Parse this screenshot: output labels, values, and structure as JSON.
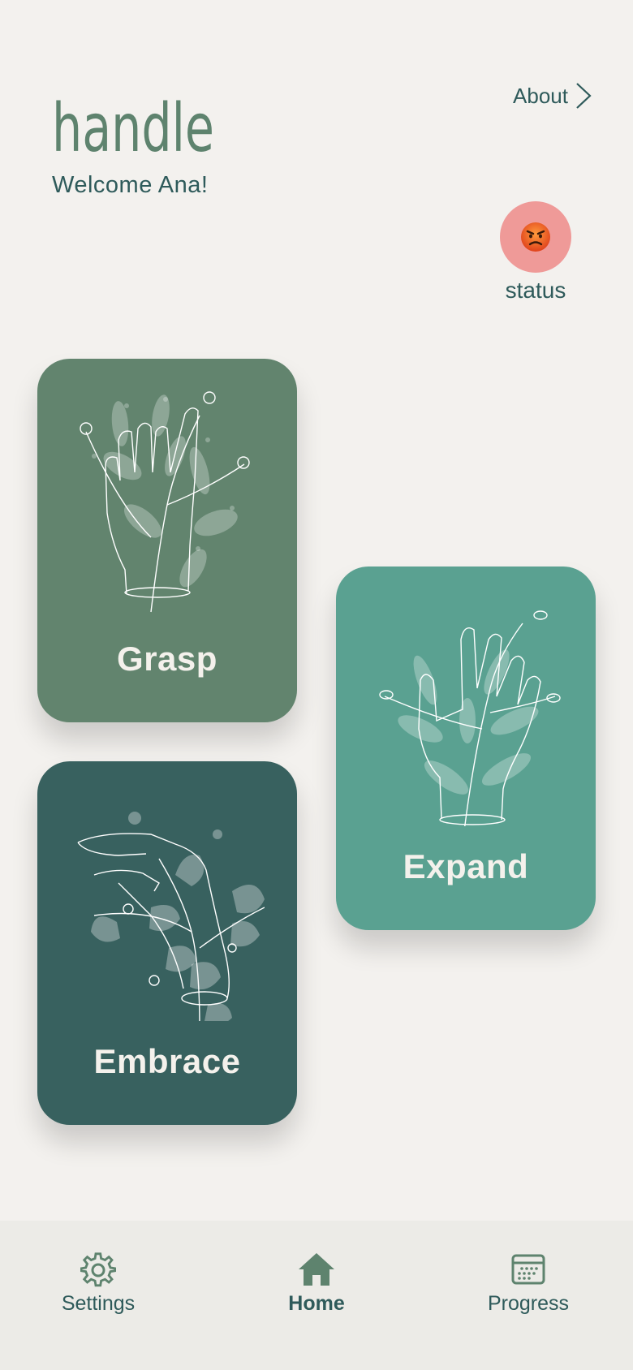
{
  "header": {
    "logo_text": "handle",
    "welcome": "Welcome Ana!",
    "about_label": "About"
  },
  "status": {
    "label": "status",
    "mood_icon": "angry-face-icon",
    "circle_color": "#ef9a98"
  },
  "cards": [
    {
      "label": "Grasp",
      "color": "#62846e"
    },
    {
      "label": "Expand",
      "color": "#5aa191"
    },
    {
      "label": "Embrace",
      "color": "#38615f"
    }
  ],
  "nav": {
    "items": [
      {
        "label": "Settings",
        "icon": "gear-icon"
      },
      {
        "label": "Home",
        "icon": "home-icon",
        "active": true
      },
      {
        "label": "Progress",
        "icon": "calendar-icon"
      }
    ]
  },
  "colors": {
    "brand_green": "#62846e",
    "text_dark": "#2e5a5a",
    "background": "#f3f1ee"
  }
}
